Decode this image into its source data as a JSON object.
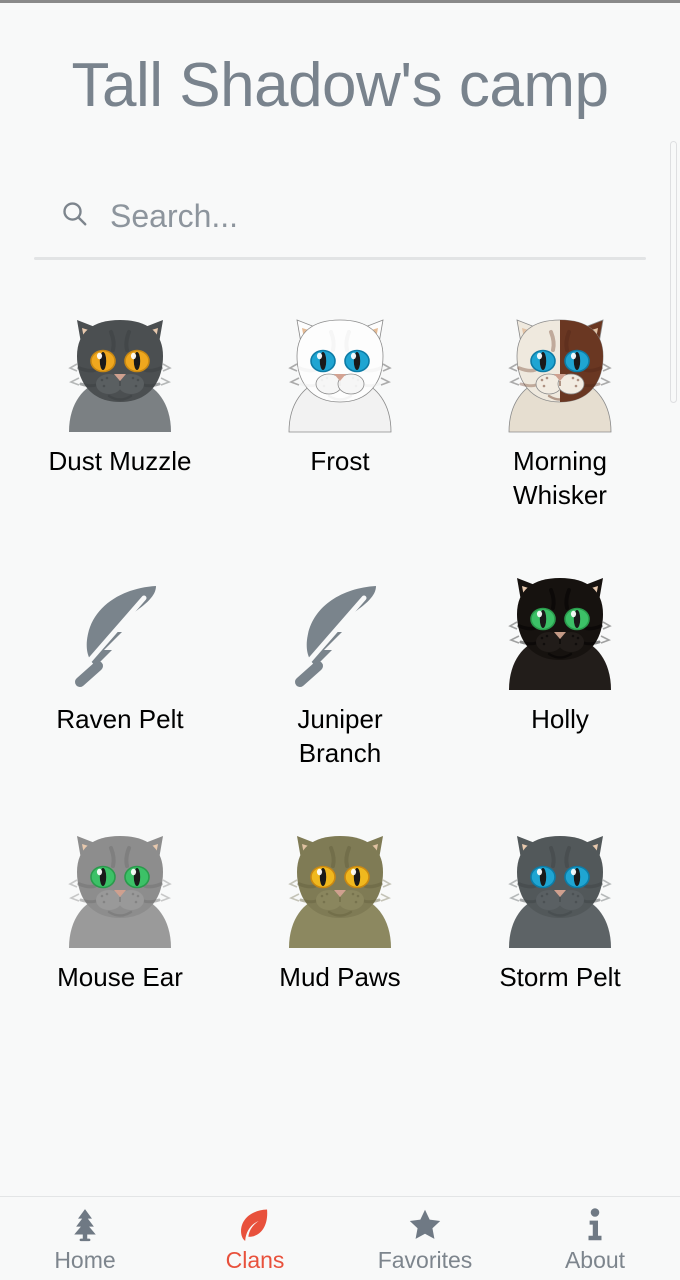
{
  "app": {
    "background_color": "#f8f9f9",
    "accent_color": "#e8513c",
    "muted_color": "#7d858d"
  },
  "header": {
    "title": "Tall Shadow's camp"
  },
  "search": {
    "icon": "search-icon",
    "value": "",
    "placeholder": "Search..."
  },
  "grid": {
    "cats": [
      {
        "name": "Dust Muzzle",
        "art": "cat",
        "fur": "#4b4f51",
        "fur_dark": "#3a3e40",
        "fur_light": "#5d6264",
        "belly": "#7b8083",
        "ear": "#e8c9ae",
        "eye": "#f0a81e",
        "eye_dark": "#c98812",
        "nose": "#cfa08f",
        "muzzle": "#5a5f61"
      },
      {
        "name": "Frost",
        "art": "cat",
        "fur": "#fdfdfd",
        "fur_dark": "#e9e9e9",
        "fur_light": "#ffffff",
        "belly": "#f2f2f2",
        "ear": "#e5bb95",
        "eye": "#1fa5d2",
        "eye_dark": "#0d7ba5",
        "nose": "#d3a292",
        "muzzle": "#f6f6f6"
      },
      {
        "name": "Morning Whisker",
        "art": "cat-two-tone",
        "fur": "#efe9de",
        "fur_dark": "#6a3722",
        "fur_light": "#f7f3ec",
        "belly": "#e6ded0",
        "ear": "#e3c3a5",
        "eye": "#1fa5d2",
        "eye_dark": "#0d7ba5",
        "nose": "#cfa08f",
        "muzzle": "#f2ece2"
      },
      {
        "name": "Raven Pelt",
        "art": "feather",
        "fur": "#7a848c"
      },
      {
        "name": "Juniper Branch",
        "art": "feather",
        "fur": "#7a848c"
      },
      {
        "name": "Holly",
        "art": "cat",
        "fur": "#16120f",
        "fur_dark": "#000000",
        "fur_light": "#2a2422",
        "belly": "#221d1a",
        "ear": "#e8c9ae",
        "eye": "#3cc167",
        "eye_dark": "#2a9b4c",
        "nose": "#c49a86",
        "muzzle": "#211c19"
      },
      {
        "name": "Mouse Ear",
        "art": "cat",
        "fur": "#8d8d8d",
        "fur_dark": "#6f6f6f",
        "fur_light": "#a3a3a3",
        "belly": "#9a9a9a",
        "ear": "#e8c9ae",
        "eye": "#3cc167",
        "eye_dark": "#2a9b4c",
        "nose": "#cfa08f",
        "muzzle": "#999999"
      },
      {
        "name": "Mud Paws",
        "art": "cat",
        "fur": "#7f7b55",
        "fur_dark": "#65613f",
        "fur_light": "#96916a",
        "belly": "#8c8860",
        "ear": "#e0c2a2",
        "eye": "#f0b81e",
        "eye_dark": "#c98812",
        "nose": "#cfa08f",
        "muzzle": "#8a865e"
      },
      {
        "name": "Storm Pelt",
        "art": "cat",
        "fur": "#52585a",
        "fur_dark": "#3e4446",
        "fur_light": "#666d70",
        "belly": "#5d6366",
        "ear": "#e8c9ae",
        "eye": "#1fa5d2",
        "eye_dark": "#0d7ba5",
        "nose": "#cfa08f",
        "muzzle": "#5a6063"
      }
    ]
  },
  "bottom_nav": {
    "items": [
      {
        "label": "Home",
        "icon": "tree-icon",
        "active": false
      },
      {
        "label": "Clans",
        "icon": "leaf-icon",
        "active": true
      },
      {
        "label": "Favorites",
        "icon": "star-icon",
        "active": false
      },
      {
        "label": "About",
        "icon": "info-icon",
        "active": false
      }
    ]
  }
}
